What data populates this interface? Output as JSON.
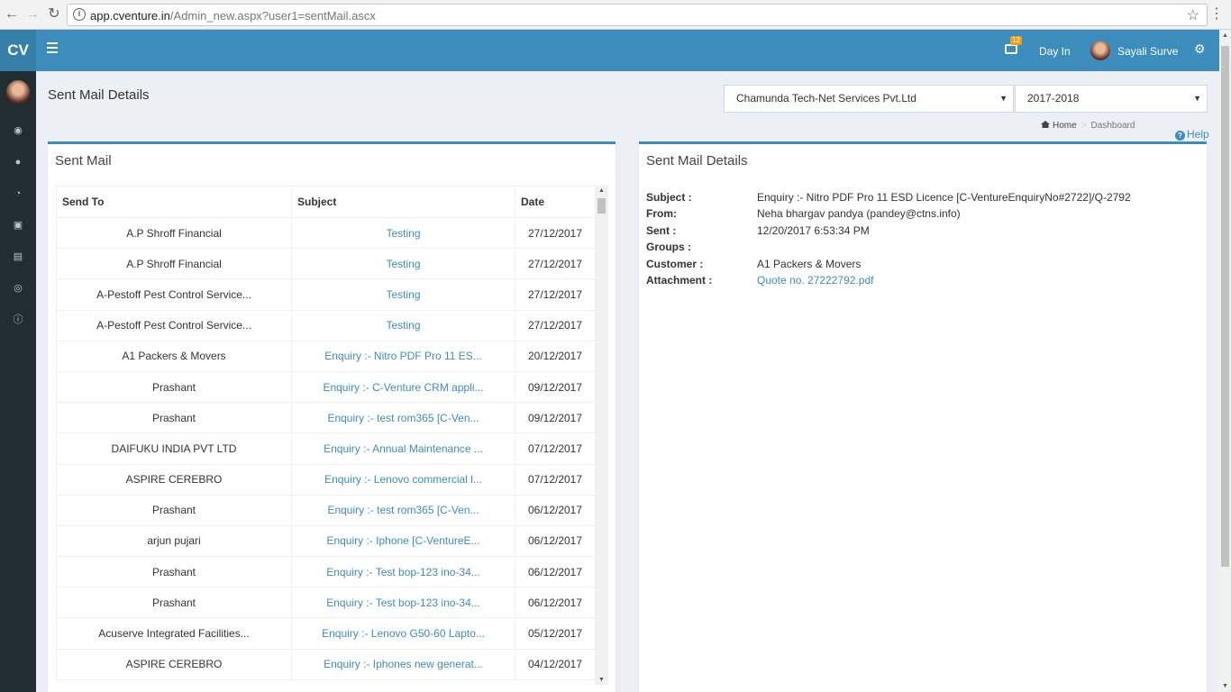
{
  "browser": {
    "url_host": "app.cventure.in",
    "url_path": "/Admin_new.aspx?user1=sentMail.ascx"
  },
  "header": {
    "logo": "CV",
    "notification_count": "12",
    "day_in_label": "Day In",
    "user_name": "Sayali Surve"
  },
  "page": {
    "title": "Sent Mail Details",
    "company_select": "Chamunda Tech-Net Services Pvt.Ltd",
    "year_select": "2017-2018",
    "breadcrumb_home": "Home",
    "breadcrumb_current": "Dashboard",
    "help_label": "Help"
  },
  "sent_mail": {
    "title": "Sent Mail",
    "columns": [
      "Send To",
      "Subject",
      "Date"
    ],
    "rows": [
      {
        "to": "A.P Shroff Financial",
        "subject": "Testing",
        "date": "27/12/2017"
      },
      {
        "to": "A.P Shroff Financial",
        "subject": "Testing",
        "date": "27/12/2017"
      },
      {
        "to": "A-Pestoff Pest Control Service...",
        "subject": "Testing",
        "date": "27/12/2017"
      },
      {
        "to": "A-Pestoff Pest Control Service...",
        "subject": "Testing",
        "date": "27/12/2017"
      },
      {
        "to": "A1 Packers & Movers",
        "subject": "Enquiry :- Nitro PDF Pro 11 ES...",
        "date": "20/12/2017"
      },
      {
        "to": "Prashant",
        "subject": "Enquiry :- C-Venture CRM appli...",
        "date": "09/12/2017"
      },
      {
        "to": "Prashant",
        "subject": "Enquiry :- test rom365 [C-Ven...",
        "date": "09/12/2017"
      },
      {
        "to": "DAIFUKU INDIA PVT LTD",
        "subject": "Enquiry :- Annual Maintenance ...",
        "date": "07/12/2017"
      },
      {
        "to": "ASPIRE CEREBRO",
        "subject": "Enquiry :- Lenovo commercial l...",
        "date": "07/12/2017"
      },
      {
        "to": "Prashant",
        "subject": "Enquiry :- test rom365 [C-Ven...",
        "date": "06/12/2017"
      },
      {
        "to": "arjun pujari",
        "subject": "Enquiry :- Iphone [C-VentureE...",
        "date": "06/12/2017"
      },
      {
        "to": "Prashant",
        "subject": "Enquiry :- Test bop-123 ino-34...",
        "date": "06/12/2017"
      },
      {
        "to": "Prashant",
        "subject": "Enquiry :- Test bop-123 ino-34...",
        "date": "06/12/2017"
      },
      {
        "to": "Acuserve Integrated Facilities...",
        "subject": "Enquiry :- Lenovo G50-60 Lapto...",
        "date": "05/12/2017"
      },
      {
        "to": "ASPIRE CEREBRO",
        "subject": "Enquiry :- Iphones new generat...",
        "date": "04/12/2017"
      }
    ]
  },
  "details": {
    "title": "Sent Mail Details",
    "subject_label": "Subject :",
    "subject": "Enquiry :- Nitro PDF Pro 11 ESD Licence [C-VentureEnquiryNo#2722]/Q-2792",
    "from_label": "From:",
    "from": "Neha bhargav pandya (pandey@ctns.info)",
    "sent_label": "Sent :",
    "sent": "12/20/2017 6:53:34 PM",
    "groups_label": "Groups :",
    "groups": "",
    "customer_label": "Customer :",
    "customer": "A1 Packers & Movers",
    "attachment_label": "Attachment :",
    "attachment": "Quote no. 27222792.pdf"
  },
  "colors": {
    "header_blue": "#3c8dbc",
    "logo_blue": "#367fa9",
    "sidebar_dark": "#222d32",
    "link_blue": "#3c8dbc"
  },
  "icons": {
    "sidebar": [
      "dashboard-icon",
      "user-icon",
      "pie-chart-icon",
      "cart-icon",
      "credit-card-icon",
      "support-icon",
      "info-icon"
    ]
  }
}
